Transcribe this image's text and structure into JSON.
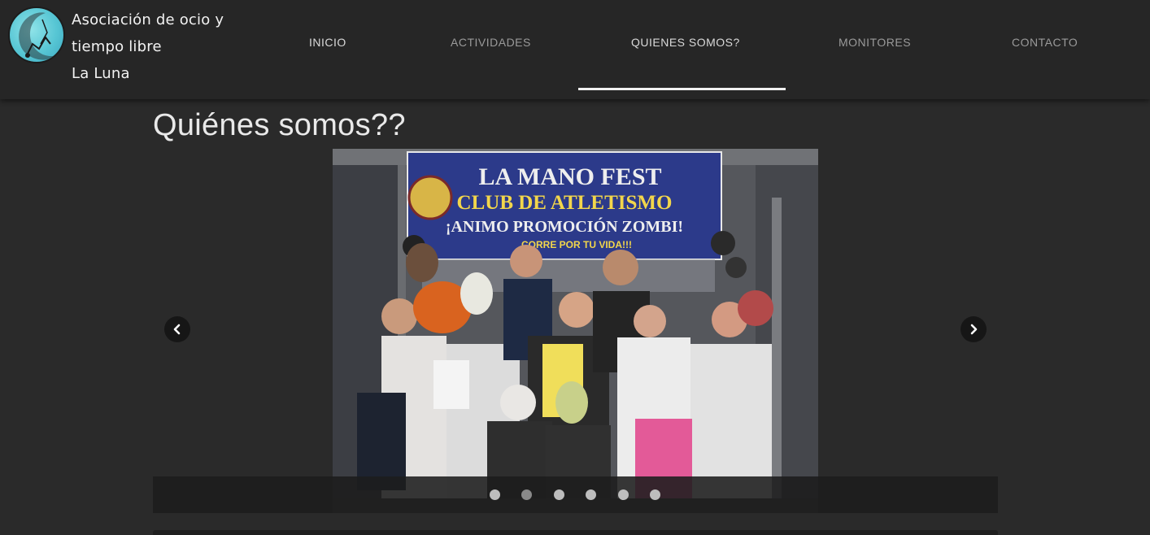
{
  "brand": {
    "line1": "Asociación de ocio y",
    "line2": "tiempo libre",
    "line3": "La Luna"
  },
  "nav": {
    "items": [
      {
        "label": "INICIO"
      },
      {
        "label": "ACTIVIDADES"
      },
      {
        "label": "QUIENES SOMOS?"
      },
      {
        "label": "MONITORES"
      },
      {
        "label": "CONTACTO"
      }
    ],
    "active_index": 2
  },
  "main": {
    "title": "Quiénes somos??"
  },
  "slider": {
    "banner_line1": "LA MANO FEST",
    "banner_line2": "CLUB DE ATLETISMO",
    "banner_line3": "¡ANIMO PROMOCIÓN ZOMBI!",
    "banner_line4": "CORRE POR TU VIDA!!!",
    "slide_count": 6,
    "active_slide": 2
  },
  "colors": {
    "background": "#2a2a2a",
    "header": "#262626",
    "banner": "#2c3a8a",
    "banner_text_yellow": "#f2d64b",
    "underline": "#f0f0f0"
  }
}
